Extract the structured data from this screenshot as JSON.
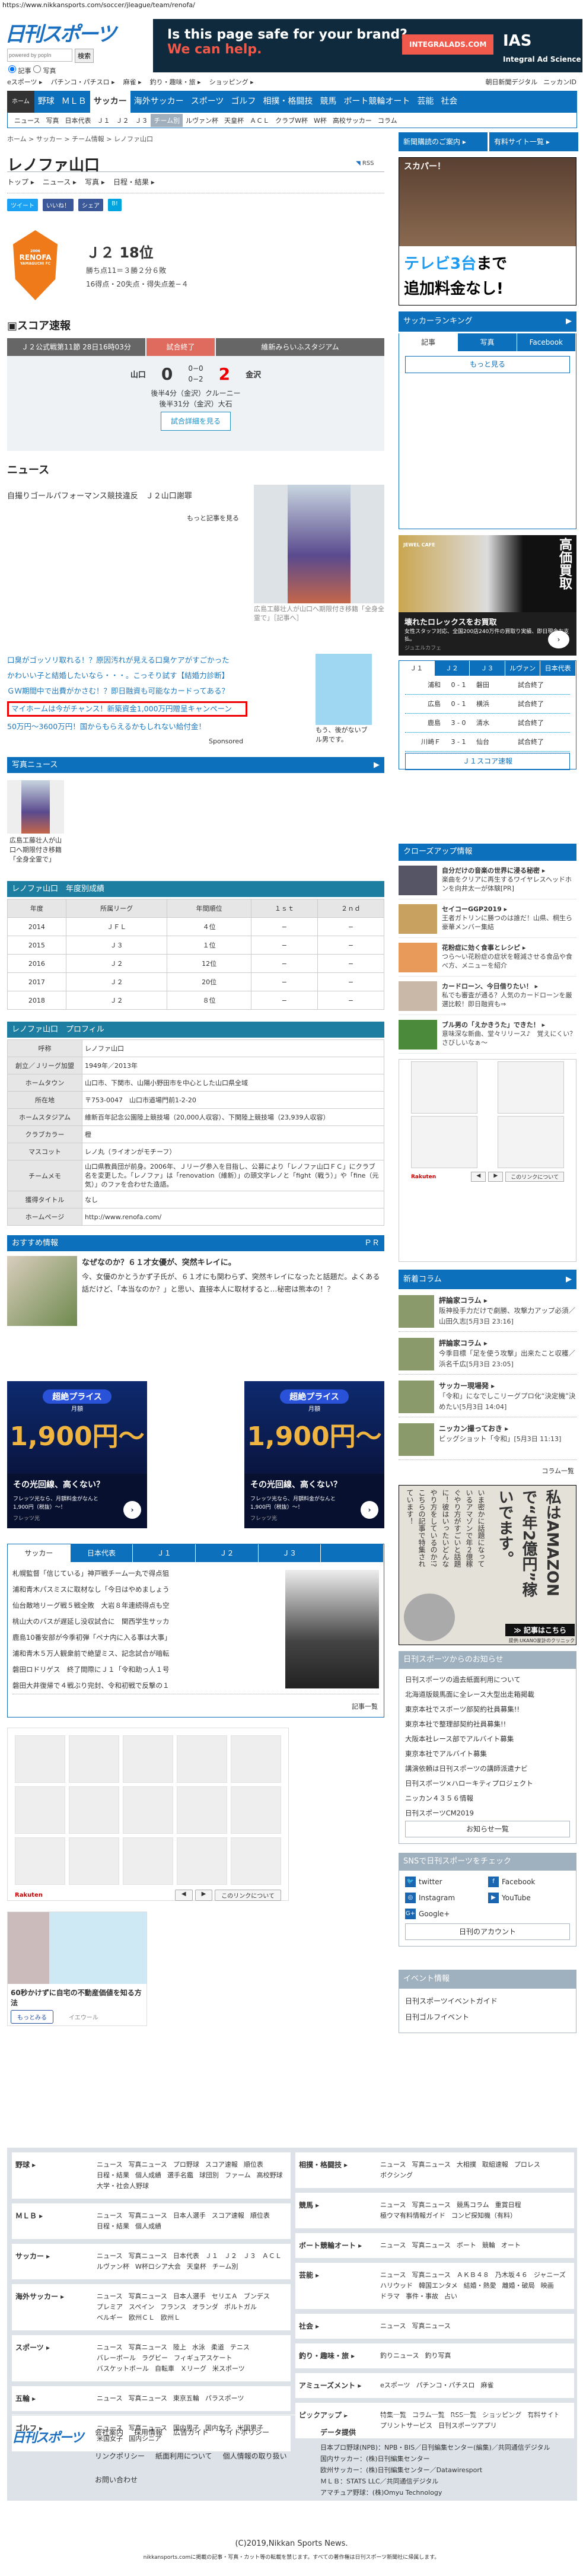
{
  "url": "https://www.nikkansports.com/soccer/jleague/team/renofa/",
  "header": {
    "logo": "日刊スポーツ",
    "search_placeholder": "powered by popIn",
    "search_button": "検索",
    "radio_article": "記事",
    "radio_photo": "写真",
    "top_links": [
      "eスポーツ",
      "パチンコ・パチスロ",
      "麻雀",
      "釣り・趣味・旅",
      "ショッピング"
    ],
    "right_links": [
      "朝日新聞デジタル",
      "ニッカンID"
    ]
  },
  "banner": {
    "line1": "Is this page safe for your brand?",
    "line2": "We can help.",
    "cta": "INTEGRALADS.COM",
    "brand": "IAS",
    "brand_sub": "Integral Ad Science"
  },
  "main_nav": [
    "ホーム",
    "野球",
    "ＭＬＢ",
    "サッカー",
    "海外サッカー",
    "スポーツ",
    "ゴルフ",
    "相撲・格闘技",
    "競馬",
    "ボート競輪オート",
    "芸能",
    "社会"
  ],
  "category_nav": [
    "ニュース",
    "写真",
    "日本代表",
    "Ｊ１",
    "Ｊ２",
    "Ｊ３",
    "チーム別",
    "ルヴァン杯",
    "天皇杯",
    "ＡＣＬ",
    "クラブW杯",
    "W杯",
    "高校サッカー",
    "コラム"
  ],
  "breadcrumb": "ホーム > サッカー > チーム情報 > レノファ山口",
  "top_buttons": [
    "新聞購読のご案内",
    "有料サイト一覧"
  ],
  "team": {
    "name": "レノファ山口",
    "rss": "RSS",
    "tabs": [
      "トップ",
      "ニュース",
      "写真",
      "日程・結果"
    ],
    "share": [
      "ツイート",
      "いいね！",
      "シェア",
      "B!"
    ],
    "crest_text": "RENOFA",
    "crest_sub": "YAMAGUCHI FC",
    "rank": "Ｊ２ 18位",
    "points": "勝ち点11＝３勝２分６敗",
    "goals": "16得点・20失点・得失点差−４"
  },
  "score": {
    "heading": "スコア速報",
    "match_info": "Ｊ２公式戦第11節 28日16時03分",
    "status": "試合終了",
    "stadium": "維新みらいふスタジアム",
    "home": "山口",
    "home_score": "0",
    "half1": "0−0",
    "half2": "0−2",
    "away_score": "2",
    "away": "金沢",
    "goals": [
      "後半4分（金沢）クルーニー",
      "後半31分（金沢）大石"
    ],
    "detail_button": "試合詳細を見る"
  },
  "news": {
    "heading": "ニュース",
    "item": "自撮りゴールパフォーマンス競技違反　Ｊ２山口謝罪",
    "more": "もっと記事を見る",
    "photo_caption": "広島工藤壮人が山口へ期限付き移籍「全身全霊で」［記事へ］"
  },
  "sponsored": {
    "links": [
      "口臭がゴッソリ取れる！？原因汚れが見える口臭ケアがすごかった",
      "かわいい子と結婚したいなら・・・。こっそり試す【結婚力診断】",
      "ＧＷ期間中で出費がかさむ！？即日融資も可能なカードってある？",
      "マイホームは今がチャンス！新築資金1,000万円贈呈キャンペーン",
      "50万円〜3600万円！国からもらえるかもしれない給付金！"
    ],
    "label": "Sponsored",
    "side_caption": "もう、後がないブル男です。"
  },
  "photo_news": {
    "heading": "写真ニュース",
    "caption": "広島工藤壮人が山口へ期限付き移籍「全身全霊で」"
  },
  "season_table": {
    "heading": "レノファ山口　年度別成績",
    "columns": [
      "年度",
      "所属リーグ",
      "年間順位",
      "１ｓｔ",
      "２ｎｄ"
    ],
    "rows": [
      [
        "2014",
        "ＪＦＬ",
        "４位",
        "−",
        "−"
      ],
      [
        "2015",
        "Ｊ３",
        "１位",
        "−",
        "−"
      ],
      [
        "2016",
        "Ｊ２",
        "12位",
        "−",
        "−"
      ],
      [
        "2017",
        "Ｊ２",
        "20位",
        "−",
        "−"
      ],
      [
        "2018",
        "Ｊ２",
        "８位",
        "−",
        "−"
      ]
    ]
  },
  "profile": {
    "heading": "レノファ山口　プロフィル",
    "rows": [
      [
        "呼称",
        "レノファ山口"
      ],
      [
        "創立／Ｊリーグ加盟",
        "1949年／2013年"
      ],
      [
        "ホームタウン",
        "山口市、下関市、山陽小野田市を中心とした山口県全域"
      ],
      [
        "所在地",
        "〒753-0047　山口市道場門前1-2-20"
      ],
      [
        "ホームスタジアム",
        "維新百年記念公園陸上競技場（20,000人収容）、下関陸上競技場（23,939人収容）"
      ],
      [
        "クラブカラー",
        "橙"
      ],
      [
        "マスコット",
        "レノ丸（ライオンがモチーフ）"
      ],
      [
        "チームメモ",
        "山口県教員団が前身。2006年、Ｊリーグ参入を目指し、公募により「レノファ山口ＦＣ」にクラブ名を変更した。「レノファ」は「renovation（維新）」の頭文字レノと「fight（戦う）」や「fine（元気）」のファを合わせた造語。"
      ],
      [
        "獲得タイトル",
        "なし"
      ],
      [
        "ホームページ",
        "http://www.renofa.com/"
      ]
    ]
  },
  "recommend": {
    "heading": "おすすめ情報",
    "pr": "ＰＲ",
    "title": "なぜなのか？６１才女優が、突然キレイに。",
    "body": "今、女優のかとうかず子氏が、６１才にも関わらず、突然キレイになったと話題だ。よくある話だけど、「本当なのか？」と思い、直接本人に取材すると…秘密は熊本の！？"
  },
  "flets_ad": {
    "pill": "超絶プライス",
    "month": "月額",
    "price": "1,900円〜",
    "title": "その光回線、高くない？",
    "desc": "フレッツ光なら、月額料金がなんと1,900円（税抜）〜！",
    "sponsor": "フレッツ光"
  },
  "soccer_tabs": {
    "tabs": [
      "サッカー",
      "日本代表",
      "Ｊ１",
      "Ｊ２",
      "Ｊ３",
      ""
    ],
    "items": [
      "札幌監督「信じている」神戸戦チーム一丸で得点狙う",
      "浦和青木パスミスに取材なし「今日はやめましょう」",
      "仙台敵地リーグ戦５戦全敗　大岩８年連続得点も空砲",
      "桃山大のバスが遅延し没収試合に　関西学生サッカー",
      "鹿島10番安部が今季初弾「ペナ内に入る事は大事」",
      "浦和青木５万人観衆前で絶望ミス、記念試合が暗転…",
      "磐田ロドリゲス　終了間際にＪ１「令和助っ人１号」",
      "磐田大井復帰で４戦ぶり完封、令和初戦で反撃の１歩"
    ],
    "more": "記事一覧"
  },
  "rakuten": {
    "logo": "Rakuten",
    "prev": "◀",
    "next": "▶",
    "about": "このリンクについて"
  },
  "realestate_ad": {
    "title": "60秒かけずに自宅の不動産価値を知る方法",
    "button": "もっとみる",
    "sponsor": "イエウール"
  },
  "sidebar": {
    "skyper_ad": {
      "brand": "スカパー！",
      "line1a": "テレビ3台",
      "line1b": "まで",
      "line2": "追加料金なし!"
    },
    "ranking": {
      "heading": "サッカーランキング",
      "tabs": [
        "記事",
        "写真",
        "Facebook"
      ],
      "more": "もっと見る"
    },
    "jewel_ad": {
      "brand": "JEWEL CAFE",
      "vertical": "高価買取",
      "title": "壊れたロレックスをお買取",
      "desc": "女性スタッフ対応、全国200店240万件の買取り実績、即日現金お支払。",
      "sponsor": "ジュエルカフェ"
    },
    "scores": {
      "tabs": [
        "Ｊ１",
        "Ｊ２",
        "Ｊ３",
        "ルヴァン",
        "日本代表"
      ],
      "rows": [
        [
          "浦和",
          "0 - 1",
          "磐田",
          "試合終了"
        ],
        [
          "広島",
          "0 - 1",
          "横浜",
          "試合終了"
        ],
        [
          "鹿島",
          "3 - 0",
          "清水",
          "試合終了"
        ],
        [
          "川崎Ｆ",
          "3 - 1",
          "仙台",
          "試合終了"
        ]
      ],
      "button": "Ｊ１スコア速報"
    },
    "closeup": {
      "heading": "クローズアップ情報",
      "items": [
        {
          "title": "自分だけの音楽の世界に浸る秘密",
          "text": "楽曲をクリアに再生するワイヤレスヘッドホンを向井太一が体験[PR]"
        },
        {
          "title": "セイコーGGP2019",
          "text": "王者ガトリンに勝つのは誰だ！山県、桐生ら豪華メンバー集結"
        },
        {
          "title": "花粉症に効く食事とレシピ",
          "text": "つら〜い花粉症の症状を軽減させる食品や食べ方、メニューを紹介"
        },
        {
          "title": "カードローン、今日借りたい！",
          "text": "私でも審査が通る？人気のカードローンを厳選比較！即日融資も⇒"
        },
        {
          "title": "ブル男の「えかきうた」できた！",
          "text": "意味深な新曲、堂々リリース♪　覚えにくい？さびしいなぁ〜"
        }
      ]
    },
    "columns": {
      "heading": "新着コラム",
      "items": [
        {
          "title": "評論家コラム",
          "text": "阪神投手力だけで劇勝、攻撃力アップ必須／山田久志",
          "date": "[5月3日 23:16]"
        },
        {
          "title": "評論家コラム",
          "text": "今季目標「足を使う攻撃」出来たこと収穫／浜名千広",
          "date": "[5月3日 23:05]"
        },
        {
          "title": "サッカー現場発",
          "text": "「令和」になでしこリーグプロ化“決定機”決めたい",
          "date": "[5月3日 14:04]"
        },
        {
          "title": "ニッカン撮っておき",
          "text": "ビッグショット「令和」",
          "date": "[5月3日 11:13]"
        }
      ],
      "more": "コラム一覧"
    },
    "amazon_ad": {
      "headline": "私はAMAZONで“年2億円”稼いでます。",
      "body": "いま密かに話題になっているアマゾンで年２億稼ぐやり方がすごいと話題に！彼はいったいどんなやり方をしているのか!?こちらの記事で特集されています！",
      "cta": "≫ 記事はこちら",
      "provider": "提供:UKANO家計のクリニック"
    },
    "notices": {
      "heading": "日刊スポーツからのお知らせ",
      "items": [
        "日刊スポーツの過去紙面利用について",
        "北海道版競馬面に全レース大型出走箱掲載",
        "東京本社でスポーツ部契約社員募集!!",
        "東京本社で整理部契約社員募集!!",
        "大阪本社レース部でアルバイト募集",
        "東京本社でアルバイト募集",
        "講演依頼は日刊スポーツの講師派遣ナビ",
        "日刊スポーツ×ハローキティプロジェクト",
        "ニッカン４３５６情報",
        "日刊スポーツCM2019"
      ],
      "more": "お知らせ一覧"
    },
    "sns": {
      "heading": "SNSで日刊スポーツをチェック",
      "items": [
        "twitter",
        "Facebook",
        "Instagram",
        "YouTube",
        "Google+"
      ],
      "more": "日刊のアカウント"
    },
    "events": {
      "heading": "イベント情報",
      "items": [
        "日刊スポーツイベントガイド",
        "日刊ゴルフイベント"
      ]
    }
  },
  "footer": {
    "left": [
      {
        "h": "野球",
        "links": [
          "ニュース",
          "写真ニュース",
          "プロ野球",
          "スコア速報",
          "順位表",
          "日程・結果",
          "個人成績",
          "選手名鑑",
          "球団別",
          "ファーム",
          "高校野球",
          "大学・社会人野球"
        ]
      },
      {
        "h": "ＭＬＢ",
        "links": [
          "ニュース",
          "写真ニュース",
          "日本人選手",
          "スコア速報",
          "順位表",
          "日程・結果",
          "個人成績"
        ]
      },
      {
        "h": "サッカー",
        "links": [
          "ニュース",
          "写真ニュース",
          "日本代表",
          "Ｊ１",
          "Ｊ２",
          "Ｊ３",
          "ＡＣＬ",
          "ルヴァン杯",
          "W杯ロシア大会",
          "天皇杯",
          "チーム別"
        ]
      },
      {
        "h": "海外サッカー",
        "links": [
          "ニュース",
          "写真ニュース",
          "日本人選手",
          "セリエＡ",
          "ブンデス",
          "プレミア",
          "スペイン",
          "フランス",
          "オランダ",
          "ポルトガル",
          "ベルギー",
          "欧州ＣＬ",
          "欧州Ｌ"
        ]
      },
      {
        "h": "スポーツ",
        "links": [
          "ニュース",
          "写真ニュース",
          "陸上",
          "水泳",
          "柔道",
          "テニス",
          "バレーボール",
          "ラグビー",
          "フィギュアスケート",
          "バスケットボール",
          "自転車",
          "Ｘリーグ",
          "米スポーツ"
        ]
      },
      {
        "h": "五輪",
        "links": [
          "ニュース",
          "写真ニュース",
          "東京五輪",
          "パラスポーツ"
        ]
      },
      {
        "h": "ゴルフ",
        "links": [
          "ニュース",
          "写真ニュース",
          "国内男子",
          "国内女子",
          "米国男子",
          "米国女子",
          "国内シニア"
        ]
      }
    ],
    "right": [
      {
        "h": "相撲・格闘技",
        "links": [
          "ニュース",
          "写真ニュース",
          "大相撲",
          "取組速報",
          "プロレス",
          "ボクシング"
        ]
      },
      {
        "h": "競馬",
        "links": [
          "ニュース",
          "写真ニュース",
          "競馬コラム",
          "重賞日程",
          "極ウマ有料情報ガイド",
          "コンピ探知機（有料）"
        ]
      },
      {
        "h": "ボート競輪オート",
        "links": [
          "ニュース",
          "写真ニュース",
          "ボート",
          "競輪",
          "オート"
        ]
      },
      {
        "h": "芸能",
        "links": [
          "ニュース",
          "写真ニュース",
          "ＡＫＢ４８",
          "乃木坂４６",
          "ジャニーズ",
          "ハリウッド",
          "韓国エンタメ",
          "結婚・熱愛",
          "離婚・破局",
          "映画",
          "ドラマ",
          "事件・事故",
          "占い"
        ]
      },
      {
        "h": "社会",
        "links": [
          "ニュース",
          "写真ニュース"
        ]
      },
      {
        "h": "釣り・趣味・旅",
        "links": [
          "釣りニュース",
          "釣り写真"
        ]
      },
      {
        "h": "アミューズメント",
        "links": [
          "eスポーツ",
          "パチンコ・パチスロ",
          "麻雀"
        ]
      },
      {
        "h": "ピックアップ",
        "links": [
          "特集一覧",
          "コラム一覧",
          "RSS一覧",
          "ショッピング",
          "有料サイト",
          "プリントサービス",
          "日刊スポーツアプリ"
        ]
      }
    ],
    "logo": "日刊スポーツ",
    "corp_links": [
      "会社案内",
      "採用情報",
      "広告ガイド",
      "サイトポリシー",
      "リンクポリシー",
      "紙面利用について",
      "個人情報の取り扱い",
      "お問い合わせ"
    ],
    "data_heading": "データ提供",
    "data_lines": [
      "日本プロ野球(NPB)：NPB・BIS／日刊編集センター(編集)／共同通信デジタル",
      "国内サッカー：(株)日刊編集センター",
      "欧州サッカー：(株)日刊編集センター／Datawiresport",
      "ＭＬＢ：STATS LLC／共同通信デジタル",
      "アマチュア野球：(株)Omyu Technology"
    ],
    "copyright": "(C)2019,Nikkan Sports News.",
    "notice": "nikkansports.comに掲載の記事・写真・カット等の転載を禁じます。すべての著作権は日刊スポーツ新聞社に帰属します。"
  },
  "colors": {
    "brand_blue": "#0d70bd",
    "table_teal": "#1e7ea1",
    "status_red": "#df6a5e",
    "sidebar_gray": "#9fb0bf"
  }
}
